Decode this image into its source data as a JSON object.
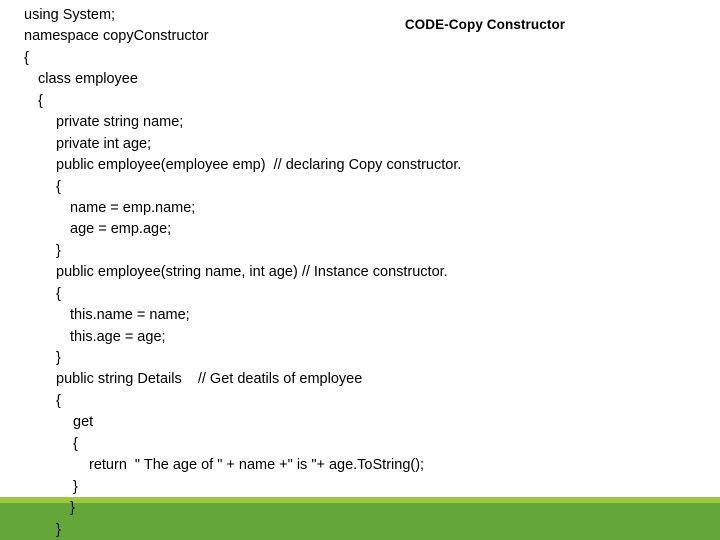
{
  "slide": {
    "title": "CODE-Copy Constructor",
    "background_color": "#FFFFFF",
    "text_color": "#000000"
  },
  "decoration": {
    "band_light_color": "#9BC93C",
    "band_dark_color": "#64A637"
  },
  "code": {
    "language": "C#",
    "lines": [
      {
        "indent": 0,
        "text": "using System;"
      },
      {
        "indent": 0,
        "text": "namespace copyConstructor"
      },
      {
        "indent": 0,
        "text": "{"
      },
      {
        "indent": 1,
        "text": "class employee"
      },
      {
        "indent": 1,
        "text": "{"
      },
      {
        "indent": 2,
        "text": "private string name;"
      },
      {
        "indent": 2,
        "text": "private int age;"
      },
      {
        "indent": 2,
        "text": "public employee(employee emp)  // declaring Copy constructor."
      },
      {
        "indent": 2,
        "text": "{"
      },
      {
        "indent": 3,
        "text": "name = emp.name;"
      },
      {
        "indent": 3,
        "text": "age = emp.age;"
      },
      {
        "indent": 2,
        "text": "}"
      },
      {
        "indent": 2,
        "text": "public employee(string name, int age) // Instance constructor."
      },
      {
        "indent": 2,
        "text": "{"
      },
      {
        "indent": 3,
        "text": "this.name = name;"
      },
      {
        "indent": 3,
        "text": "this.age = age;"
      },
      {
        "indent": 2,
        "text": "}"
      },
      {
        "indent": 2,
        "text": "public string Details    // Get deatils of employee"
      },
      {
        "indent": 2,
        "text": "{"
      },
      {
        "indent": 4,
        "text": "get"
      },
      {
        "indent": 4,
        "text": "{"
      },
      {
        "indent": 5,
        "text": "return  \" The age of \" + name +\" is \"+ age.ToString();"
      },
      {
        "indent": 4,
        "text": "}"
      },
      {
        "indent": 3,
        "text": "}"
      },
      {
        "indent": 2,
        "text": "}"
      }
    ]
  }
}
